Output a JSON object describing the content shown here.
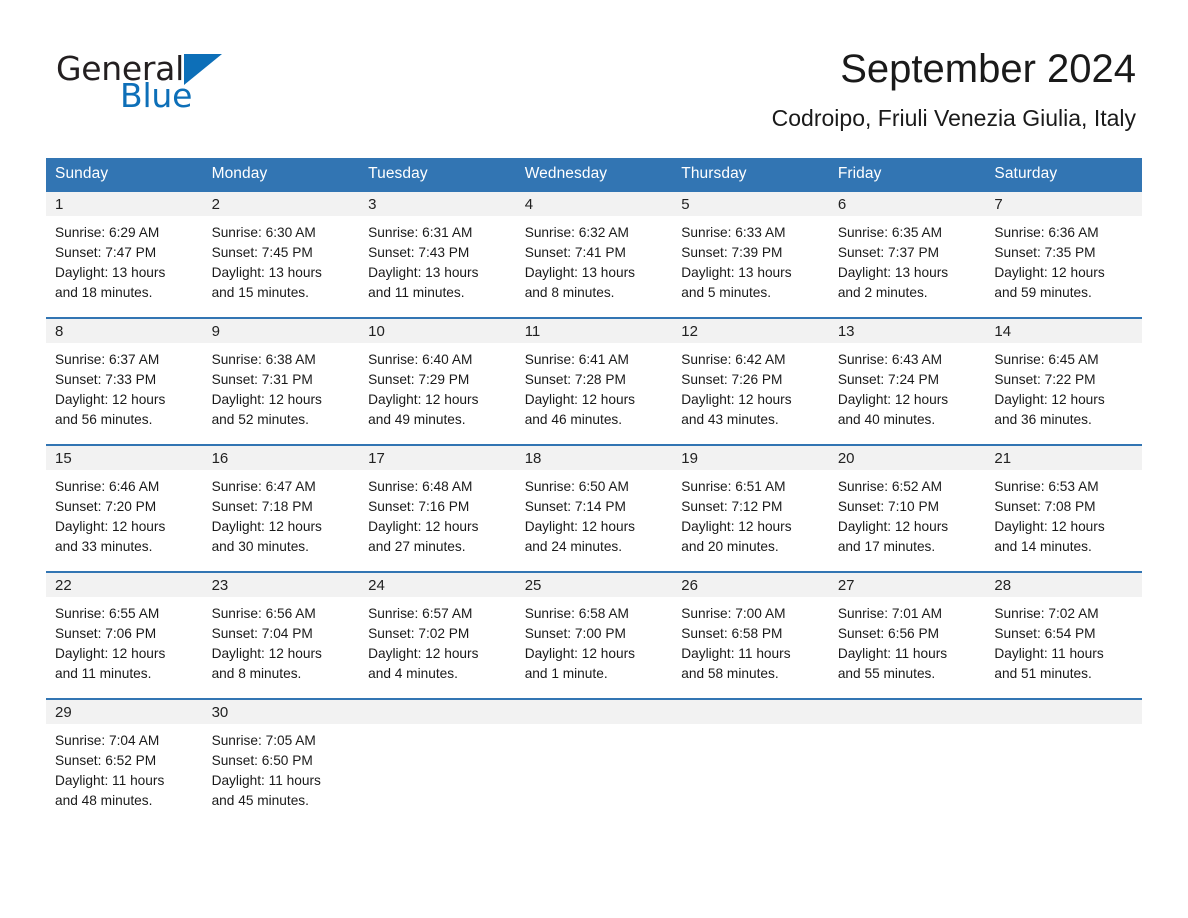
{
  "brand": {
    "name_part1": "General",
    "name_part2": "Blue",
    "triangle_color": "#0d6fb8"
  },
  "header": {
    "title": "September 2024",
    "subtitle": "Codroipo, Friuli Venezia Giulia, Italy",
    "header_bg_color": "#3275b3",
    "daynum_bg_color": "#f2f2f2"
  },
  "weekday_headers": [
    "Sunday",
    "Monday",
    "Tuesday",
    "Wednesday",
    "Thursday",
    "Friday",
    "Saturday"
  ],
  "weeks": [
    [
      {
        "day": "1",
        "sunrise": "Sunrise: 6:29 AM",
        "sunset": "Sunset: 7:47 PM",
        "daylight_line1": "Daylight: 13 hours",
        "daylight_line2": "and 18 minutes."
      },
      {
        "day": "2",
        "sunrise": "Sunrise: 6:30 AM",
        "sunset": "Sunset: 7:45 PM",
        "daylight_line1": "Daylight: 13 hours",
        "daylight_line2": "and 15 minutes."
      },
      {
        "day": "3",
        "sunrise": "Sunrise: 6:31 AM",
        "sunset": "Sunset: 7:43 PM",
        "daylight_line1": "Daylight: 13 hours",
        "daylight_line2": "and 11 minutes."
      },
      {
        "day": "4",
        "sunrise": "Sunrise: 6:32 AM",
        "sunset": "Sunset: 7:41 PM",
        "daylight_line1": "Daylight: 13 hours",
        "daylight_line2": "and 8 minutes."
      },
      {
        "day": "5",
        "sunrise": "Sunrise: 6:33 AM",
        "sunset": "Sunset: 7:39 PM",
        "daylight_line1": "Daylight: 13 hours",
        "daylight_line2": "and 5 minutes."
      },
      {
        "day": "6",
        "sunrise": "Sunrise: 6:35 AM",
        "sunset": "Sunset: 7:37 PM",
        "daylight_line1": "Daylight: 13 hours",
        "daylight_line2": "and 2 minutes."
      },
      {
        "day": "7",
        "sunrise": "Sunrise: 6:36 AM",
        "sunset": "Sunset: 7:35 PM",
        "daylight_line1": "Daylight: 12 hours",
        "daylight_line2": "and 59 minutes."
      }
    ],
    [
      {
        "day": "8",
        "sunrise": "Sunrise: 6:37 AM",
        "sunset": "Sunset: 7:33 PM",
        "daylight_line1": "Daylight: 12 hours",
        "daylight_line2": "and 56 minutes."
      },
      {
        "day": "9",
        "sunrise": "Sunrise: 6:38 AM",
        "sunset": "Sunset: 7:31 PM",
        "daylight_line1": "Daylight: 12 hours",
        "daylight_line2": "and 52 minutes."
      },
      {
        "day": "10",
        "sunrise": "Sunrise: 6:40 AM",
        "sunset": "Sunset: 7:29 PM",
        "daylight_line1": "Daylight: 12 hours",
        "daylight_line2": "and 49 minutes."
      },
      {
        "day": "11",
        "sunrise": "Sunrise: 6:41 AM",
        "sunset": "Sunset: 7:28 PM",
        "daylight_line1": "Daylight: 12 hours",
        "daylight_line2": "and 46 minutes."
      },
      {
        "day": "12",
        "sunrise": "Sunrise: 6:42 AM",
        "sunset": "Sunset: 7:26 PM",
        "daylight_line1": "Daylight: 12 hours",
        "daylight_line2": "and 43 minutes."
      },
      {
        "day": "13",
        "sunrise": "Sunrise: 6:43 AM",
        "sunset": "Sunset: 7:24 PM",
        "daylight_line1": "Daylight: 12 hours",
        "daylight_line2": "and 40 minutes."
      },
      {
        "day": "14",
        "sunrise": "Sunrise: 6:45 AM",
        "sunset": "Sunset: 7:22 PM",
        "daylight_line1": "Daylight: 12 hours",
        "daylight_line2": "and 36 minutes."
      }
    ],
    [
      {
        "day": "15",
        "sunrise": "Sunrise: 6:46 AM",
        "sunset": "Sunset: 7:20 PM",
        "daylight_line1": "Daylight: 12 hours",
        "daylight_line2": "and 33 minutes."
      },
      {
        "day": "16",
        "sunrise": "Sunrise: 6:47 AM",
        "sunset": "Sunset: 7:18 PM",
        "daylight_line1": "Daylight: 12 hours",
        "daylight_line2": "and 30 minutes."
      },
      {
        "day": "17",
        "sunrise": "Sunrise: 6:48 AM",
        "sunset": "Sunset: 7:16 PM",
        "daylight_line1": "Daylight: 12 hours",
        "daylight_line2": "and 27 minutes."
      },
      {
        "day": "18",
        "sunrise": "Sunrise: 6:50 AM",
        "sunset": "Sunset: 7:14 PM",
        "daylight_line1": "Daylight: 12 hours",
        "daylight_line2": "and 24 minutes."
      },
      {
        "day": "19",
        "sunrise": "Sunrise: 6:51 AM",
        "sunset": "Sunset: 7:12 PM",
        "daylight_line1": "Daylight: 12 hours",
        "daylight_line2": "and 20 minutes."
      },
      {
        "day": "20",
        "sunrise": "Sunrise: 6:52 AM",
        "sunset": "Sunset: 7:10 PM",
        "daylight_line1": "Daylight: 12 hours",
        "daylight_line2": "and 17 minutes."
      },
      {
        "day": "21",
        "sunrise": "Sunrise: 6:53 AM",
        "sunset": "Sunset: 7:08 PM",
        "daylight_line1": "Daylight: 12 hours",
        "daylight_line2": "and 14 minutes."
      }
    ],
    [
      {
        "day": "22",
        "sunrise": "Sunrise: 6:55 AM",
        "sunset": "Sunset: 7:06 PM",
        "daylight_line1": "Daylight: 12 hours",
        "daylight_line2": "and 11 minutes."
      },
      {
        "day": "23",
        "sunrise": "Sunrise: 6:56 AM",
        "sunset": "Sunset: 7:04 PM",
        "daylight_line1": "Daylight: 12 hours",
        "daylight_line2": "and 8 minutes."
      },
      {
        "day": "24",
        "sunrise": "Sunrise: 6:57 AM",
        "sunset": "Sunset: 7:02 PM",
        "daylight_line1": "Daylight: 12 hours",
        "daylight_line2": "and 4 minutes."
      },
      {
        "day": "25",
        "sunrise": "Sunrise: 6:58 AM",
        "sunset": "Sunset: 7:00 PM",
        "daylight_line1": "Daylight: 12 hours",
        "daylight_line2": "and 1 minute."
      },
      {
        "day": "26",
        "sunrise": "Sunrise: 7:00 AM",
        "sunset": "Sunset: 6:58 PM",
        "daylight_line1": "Daylight: 11 hours",
        "daylight_line2": "and 58 minutes."
      },
      {
        "day": "27",
        "sunrise": "Sunrise: 7:01 AM",
        "sunset": "Sunset: 6:56 PM",
        "daylight_line1": "Daylight: 11 hours",
        "daylight_line2": "and 55 minutes."
      },
      {
        "day": "28",
        "sunrise": "Sunrise: 7:02 AM",
        "sunset": "Sunset: 6:54 PM",
        "daylight_line1": "Daylight: 11 hours",
        "daylight_line2": "and 51 minutes."
      }
    ],
    [
      {
        "day": "29",
        "sunrise": "Sunrise: 7:04 AM",
        "sunset": "Sunset: 6:52 PM",
        "daylight_line1": "Daylight: 11 hours",
        "daylight_line2": "and 48 minutes."
      },
      {
        "day": "30",
        "sunrise": "Sunrise: 7:05 AM",
        "sunset": "Sunset: 6:50 PM",
        "daylight_line1": "Daylight: 11 hours",
        "daylight_line2": "and 45 minutes."
      },
      {
        "day": "",
        "sunrise": "",
        "sunset": "",
        "daylight_line1": "",
        "daylight_line2": ""
      },
      {
        "day": "",
        "sunrise": "",
        "sunset": "",
        "daylight_line1": "",
        "daylight_line2": ""
      },
      {
        "day": "",
        "sunrise": "",
        "sunset": "",
        "daylight_line1": "",
        "daylight_line2": ""
      },
      {
        "day": "",
        "sunrise": "",
        "sunset": "",
        "daylight_line1": "",
        "daylight_line2": ""
      },
      {
        "day": "",
        "sunrise": "",
        "sunset": "",
        "daylight_line1": "",
        "daylight_line2": ""
      }
    ]
  ]
}
